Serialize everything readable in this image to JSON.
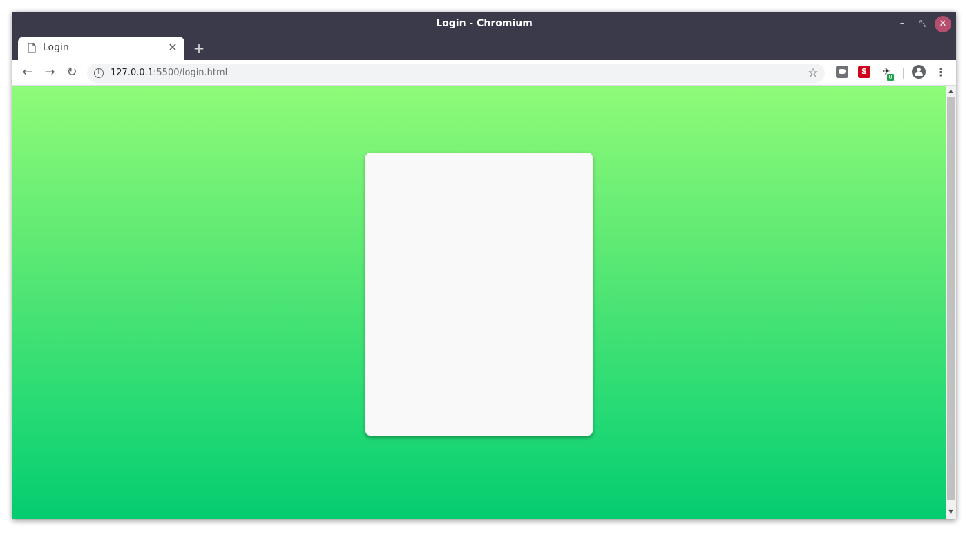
{
  "window": {
    "title": "Login - Chromium",
    "minimize_glyph": "–",
    "maximize_glyph": "⤡",
    "close_glyph": "✕"
  },
  "tabs": [
    {
      "title": "Login",
      "close_glyph": "✕",
      "icon": "page-icon"
    }
  ],
  "new_tab_glyph": "+",
  "toolbar": {
    "back_glyph": "←",
    "forward_glyph": "→",
    "reload_glyph": "↻",
    "info_glyph": "i",
    "url_host": "127.0.0.1",
    "url_rest": ":5500/login.html",
    "star_glyph": "☆",
    "extensions": [
      {
        "icon": "chat-extension-icon",
        "color": "#6e7175"
      },
      {
        "icon": "s-extension-icon",
        "label": "S",
        "color": "#d0021b"
      },
      {
        "icon": "bird-extension-icon",
        "glyph": "✈",
        "badge": "0",
        "badge_color": "#1fa34a"
      }
    ],
    "menu_glyph": "⋮"
  },
  "page": {
    "background_gradient": [
      "#8ffb78",
      "#04cc70"
    ],
    "card_color": "#f9f9fa"
  },
  "scrollbar": {
    "up_glyph": "▲",
    "down_glyph": "▼"
  }
}
